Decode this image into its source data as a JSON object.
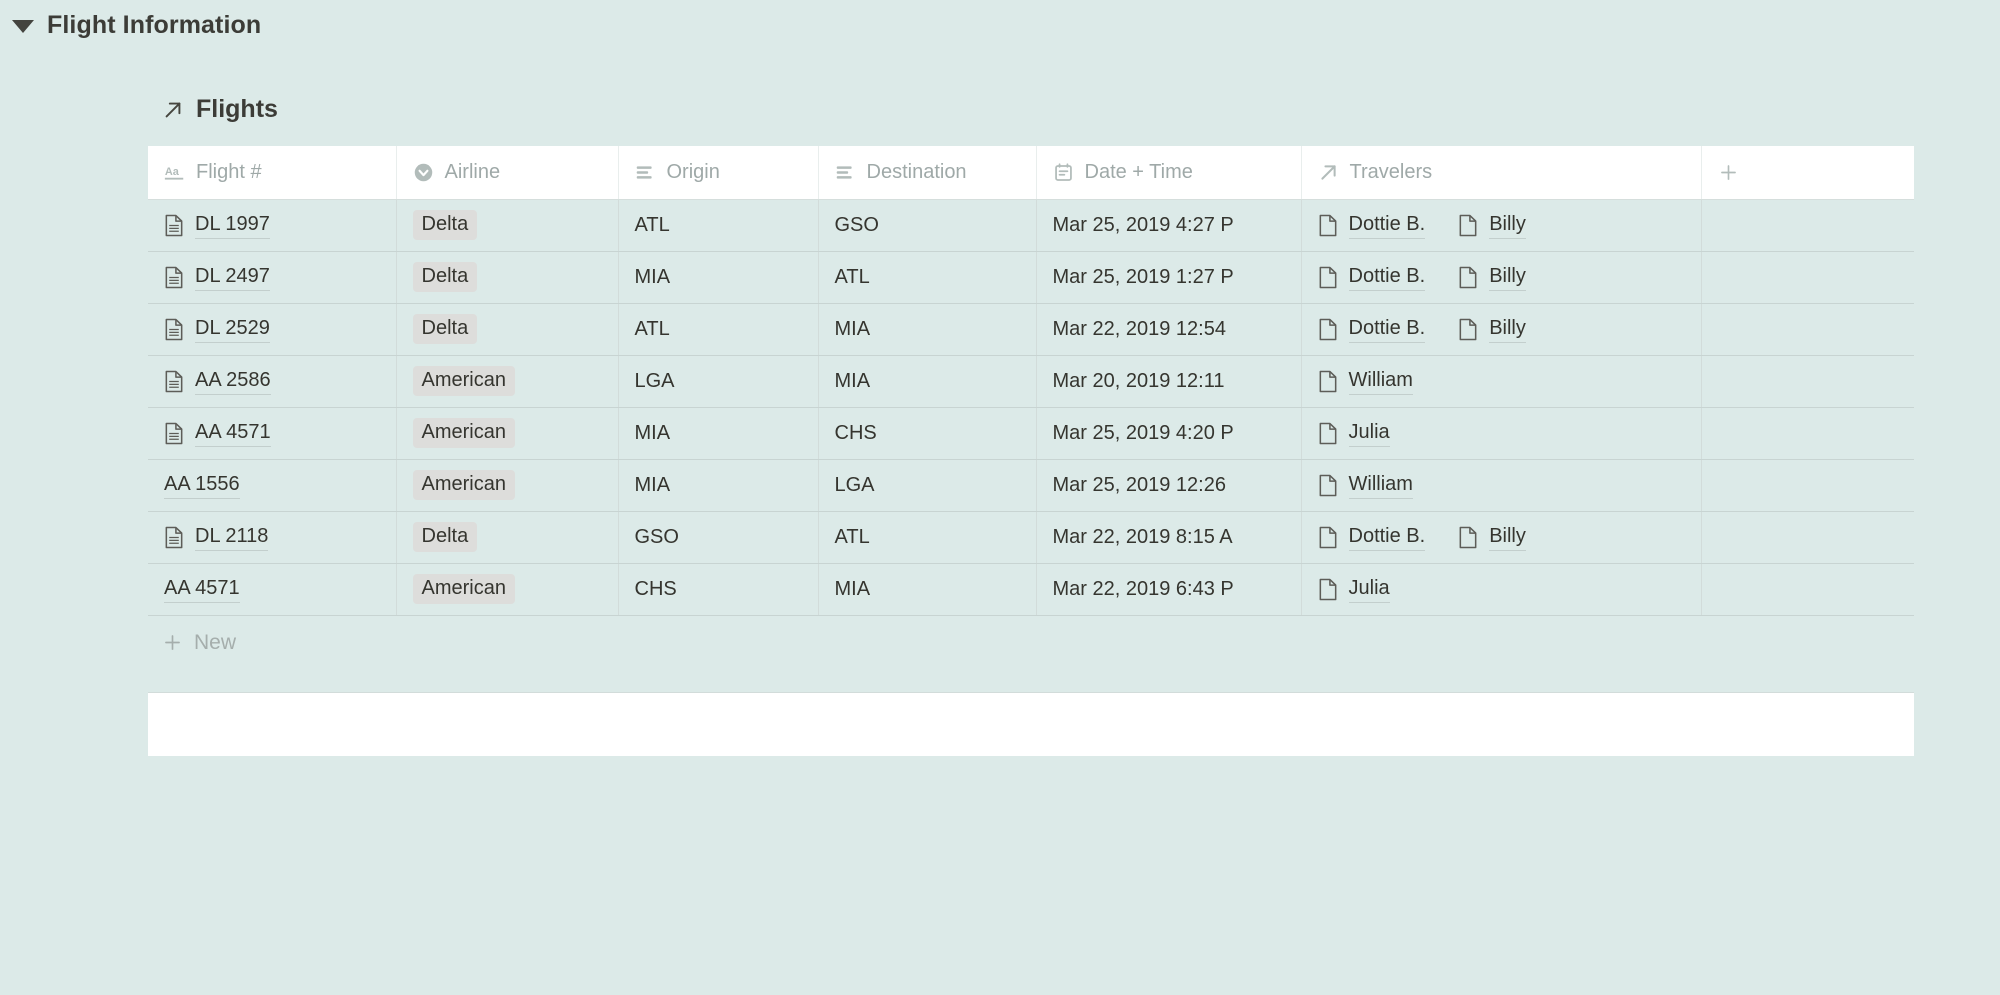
{
  "toggle": {
    "caret_icon": "triangle-down-icon",
    "title": "Flight Information"
  },
  "database": {
    "link_icon": "arrow-up-right-icon",
    "title": "Flights",
    "add_column_label": "+",
    "new_row_label": "New",
    "new_row_icon": "plus-icon",
    "columns": [
      {
        "label": "Flight #",
        "icon": "text-title-icon"
      },
      {
        "label": "Airline",
        "icon": "select-icon"
      },
      {
        "label": "Origin",
        "icon": "text-icon"
      },
      {
        "label": "Destination",
        "icon": "text-icon"
      },
      {
        "label": "Date + Time",
        "icon": "calendar-icon"
      },
      {
        "label": "Travelers",
        "icon": "relation-icon"
      }
    ],
    "rows": [
      {
        "flight": "DL 1997",
        "has_page_icon": true,
        "airline": "Delta",
        "origin": "ATL",
        "destination": "GSO",
        "datetime": "Mar 25, 2019 4:27 P",
        "travelers": [
          "Dottie B.",
          "Billy"
        ]
      },
      {
        "flight": "DL 2497",
        "has_page_icon": true,
        "airline": "Delta",
        "origin": "MIA",
        "destination": "ATL",
        "datetime": "Mar 25, 2019 1:27 P",
        "travelers": [
          "Dottie B.",
          "Billy"
        ]
      },
      {
        "flight": "DL 2529",
        "has_page_icon": true,
        "airline": "Delta",
        "origin": "ATL",
        "destination": "MIA",
        "datetime": "Mar 22, 2019 12:54",
        "travelers": [
          "Dottie B.",
          "Billy"
        ]
      },
      {
        "flight": "AA 2586",
        "has_page_icon": true,
        "airline": "American",
        "origin": "LGA",
        "destination": "MIA",
        "datetime": "Mar 20, 2019 12:11",
        "travelers": [
          "William"
        ]
      },
      {
        "flight": "AA 4571",
        "has_page_icon": true,
        "airline": "American",
        "origin": "MIA",
        "destination": "CHS",
        "datetime": "Mar 25, 2019 4:20 P",
        "travelers": [
          "Julia"
        ]
      },
      {
        "flight": "AA 1556",
        "has_page_icon": false,
        "airline": "American",
        "origin": "MIA",
        "destination": "LGA",
        "datetime": "Mar 25, 2019 12:26",
        "travelers": [
          "William"
        ]
      },
      {
        "flight": "DL 2118",
        "has_page_icon": true,
        "airline": "Delta",
        "origin": "GSO",
        "destination": "ATL",
        "datetime": "Mar 22, 2019 8:15 A",
        "travelers": [
          "Dottie B.",
          "Billy"
        ]
      },
      {
        "flight": "AA 4571",
        "has_page_icon": false,
        "airline": "American",
        "origin": "CHS",
        "destination": "MIA",
        "datetime": "Mar 22, 2019 6:43 P",
        "travelers": [
          "Julia"
        ]
      }
    ]
  },
  "colors": {
    "page_background": "#dceae8",
    "header_background": "#ffffff",
    "tag_background": "#dddddb",
    "text": "#35352f",
    "muted_text": "#9fa9a8",
    "border": "#c8d4d2"
  }
}
